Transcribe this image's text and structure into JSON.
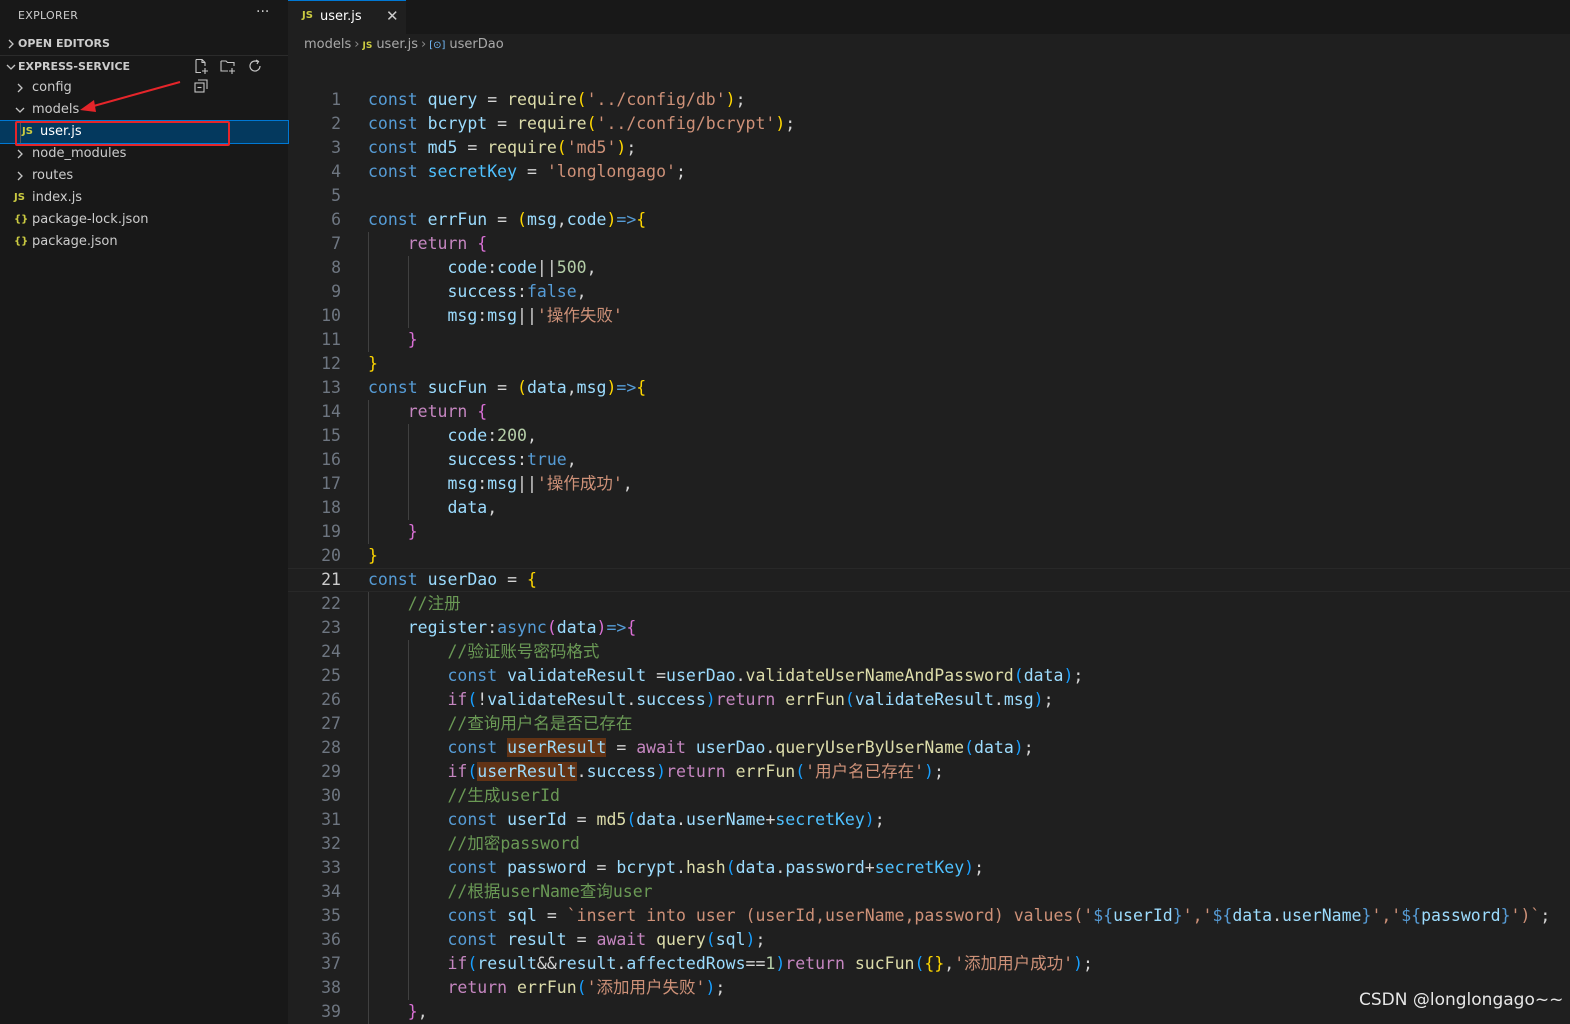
{
  "sidebar": {
    "title": "EXPLORER",
    "more": "···",
    "open_editors": "OPEN EDITORS",
    "project": "EXPRESS-SERVICE",
    "tree": [
      {
        "label": "config",
        "type": "folder",
        "expanded": false
      },
      {
        "label": "models",
        "type": "folder",
        "expanded": true
      },
      {
        "label": "user.js",
        "type": "js",
        "selected": true
      },
      {
        "label": "node_modules",
        "type": "folder",
        "expanded": false
      },
      {
        "label": "routes",
        "type": "folder",
        "expanded": false
      },
      {
        "label": "index.js",
        "type": "js"
      },
      {
        "label": "package-lock.json",
        "type": "json"
      },
      {
        "label": "package.json",
        "type": "json"
      }
    ],
    "js_icon": "JS",
    "json_icon": "{}"
  },
  "tab": {
    "label": "user.js",
    "icon": "JS",
    "close": "✕"
  },
  "breadcrumb": {
    "folder": "models",
    "file": "user.js",
    "symbol": "userDao",
    "file_icon": "JS"
  },
  "editor": {
    "current_line": 21,
    "lines": [
      "const query = require('../config/db');",
      "const bcrypt = require('../config/bcrypt');",
      "const md5 = require('md5');",
      "const secretKey = 'longlongago';",
      "",
      "const errFun = (msg,code)=>{",
      "    return {",
      "        code:code||500,",
      "        success:false,",
      "        msg:msg||'操作失败'",
      "    }",
      "}",
      "const sucFun = (data,msg)=>{",
      "    return {",
      "        code:200,",
      "        success:true,",
      "        msg:msg||'操作成功',",
      "        data,",
      "    }",
      "}",
      "const userDao = {",
      "    //注册",
      "    register:async(data)=>{",
      "        //验证账号密码格式",
      "        const validateResult =userDao.validateUserNameAndPassword(data);",
      "        if(!validateResult.success)return errFun(validateResult.msg);",
      "        //查询用户名是否已存在",
      "        const userResult = await userDao.queryUserByUserName(data);",
      "        if(userResult.success)return errFun('用户名已存在');",
      "        //生成userId",
      "        const userId = md5(data.userName+secretKey);",
      "        //加密password",
      "        const password = bcrypt.hash(data.password+secretKey);",
      "        //根据userName查询user",
      "        const sql = `insert into user (userId,userName,password) values('${userId}','${data.userName}','${password}')`;",
      "        const result = await query(sql);",
      "        if(result&&result.affectedRows==1)return sucFun({},'添加用户成功');",
      "        return errFun('添加用户失败');",
      "    },"
    ]
  },
  "watermark": "CSDN @longlongago~~"
}
